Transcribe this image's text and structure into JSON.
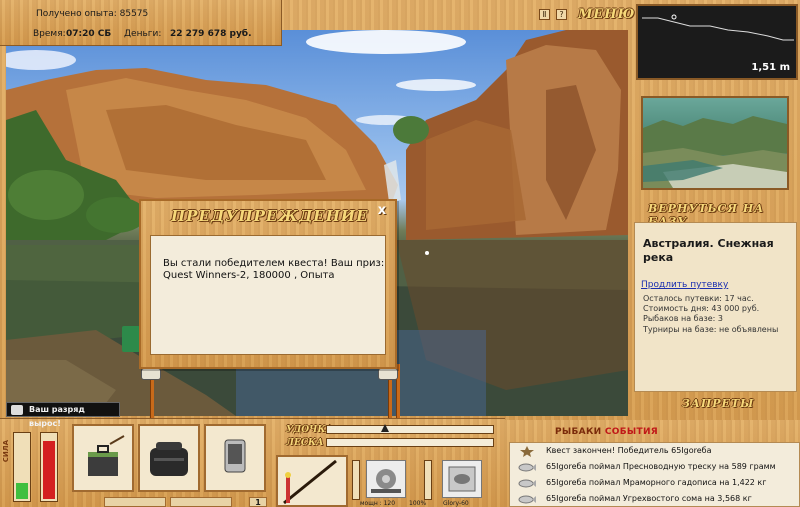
{
  "info_panel": {
    "experience_label": "Получено опыта:",
    "experience_value": "85575",
    "time_label": "Время:",
    "time_value": "07:20 СБ",
    "money_label": "Деньги:",
    "money_value": "22 279 678 руб."
  },
  "top_controls": {
    "pause_icon": "pause-icon",
    "help_label": "?",
    "menu_label": "МЕНЮ"
  },
  "depth_panel": {
    "depth_value": "1,51 m"
  },
  "right_panel": {
    "return_button": "ВЕРНУТЬСЯ НА БАЗУ",
    "location_title": "Австралия. Снежная река",
    "extend_link": "Продлить путевку",
    "time_left": "Осталось путевки: 17 час.",
    "day_cost": "Стоимость дня: 43 000 руб.",
    "anglers_on_base": "Рыбаков на базе: 3",
    "tournaments": "Турниры на базе: не объявлены",
    "bans_button": "ЗАПРЕТЫ"
  },
  "dialog": {
    "title": "ПРЕДУПРЕЖДЕНИЕ",
    "close_label": "x",
    "message_line1": "Вы стали победителем квеста! Ваш приз:",
    "message_line2": "Quest Winners-2, 180000 , Опыта"
  },
  "toast": {
    "text": "Ваш разряд вырос!"
  },
  "bottom": {
    "rod_label": "УДОЧКА",
    "line_label": "ЛЕСКА",
    "weight_left": "мощн : 120",
    "weight_right": "100%",
    "lure_label": "Glory-60",
    "page_number": "1",
    "vertical_label": "СИЛА"
  },
  "events": {
    "head_anglers": "РЫБАКИ",
    "head_events": "СОБЫТИЯ",
    "items": [
      {
        "icon": "star-icon",
        "text": "Квест закончен! Победитель 65Igoreбa"
      },
      {
        "icon": "fish-icon",
        "text": "65Igoreбa поймал Пресноводную треску на 589 грамм"
      },
      {
        "icon": "fish-icon",
        "text": "65Igoreбa поймал Мраморного гадописа на 1,422 кг"
      },
      {
        "icon": "fish-icon",
        "text": "65Igoreбa поймал Угрехвостого сома на 3,568 кг"
      }
    ]
  },
  "colors": {
    "wood": "#d8a45c",
    "gold_title": "#f6d87a",
    "meter_green": "#3fbf3f",
    "meter_red": "#d42020",
    "link_blue": "#1b2fb0"
  }
}
